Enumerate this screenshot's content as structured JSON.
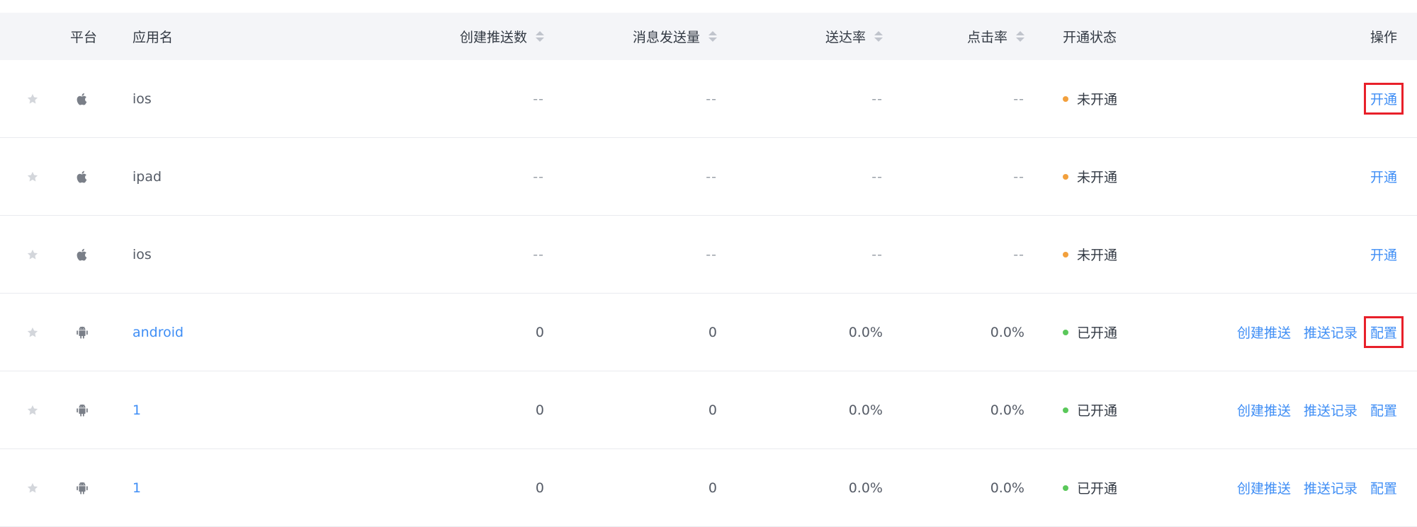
{
  "colors": {
    "link": "#3f8ef5",
    "pending_dot": "#f2a03d",
    "active_dot": "#5ac85a",
    "highlight": "#e8202a"
  },
  "table": {
    "headers": {
      "platform": "平台",
      "app_name": "应用名",
      "created_push": "创建推送数",
      "msg_sent": "消息发送量",
      "delivery_rate": "送达率",
      "click_rate": "点击率",
      "status": "开通状态",
      "actions": "操作"
    },
    "rows": [
      {
        "platform_icon": "apple-icon",
        "name": "ios",
        "name_link": false,
        "created": "--",
        "sent": "--",
        "delivery": "--",
        "click": "--",
        "status": "未开通",
        "status_color": "#f2a03d",
        "actions": [
          "开通"
        ],
        "highlight_action": "开通"
      },
      {
        "platform_icon": "apple-icon",
        "name": "ipad",
        "name_link": false,
        "created": "--",
        "sent": "--",
        "delivery": "--",
        "click": "--",
        "status": "未开通",
        "status_color": "#f2a03d",
        "actions": [
          "开通"
        ],
        "highlight_action": ""
      },
      {
        "platform_icon": "apple-icon",
        "name": "ios",
        "name_link": false,
        "created": "--",
        "sent": "--",
        "delivery": "--",
        "click": "--",
        "status": "未开通",
        "status_color": "#f2a03d",
        "actions": [
          "开通"
        ],
        "highlight_action": ""
      },
      {
        "platform_icon": "android-icon",
        "name": "android",
        "name_link": true,
        "created": "0",
        "sent": "0",
        "delivery": "0.0%",
        "click": "0.0%",
        "status": "已开通",
        "status_color": "#5ac85a",
        "actions": [
          "创建推送",
          "推送记录",
          "配置"
        ],
        "highlight_action": "配置"
      },
      {
        "platform_icon": "android-icon",
        "name": "1",
        "name_link": true,
        "created": "0",
        "sent": "0",
        "delivery": "0.0%",
        "click": "0.0%",
        "status": "已开通",
        "status_color": "#5ac85a",
        "actions": [
          "创建推送",
          "推送记录",
          "配置"
        ],
        "highlight_action": ""
      },
      {
        "platform_icon": "android-icon",
        "name": "1",
        "name_link": true,
        "created": "0",
        "sent": "0",
        "delivery": "0.0%",
        "click": "0.0%",
        "status": "已开通",
        "status_color": "#5ac85a",
        "actions": [
          "创建推送",
          "推送记录",
          "配置"
        ],
        "highlight_action": ""
      }
    ]
  }
}
